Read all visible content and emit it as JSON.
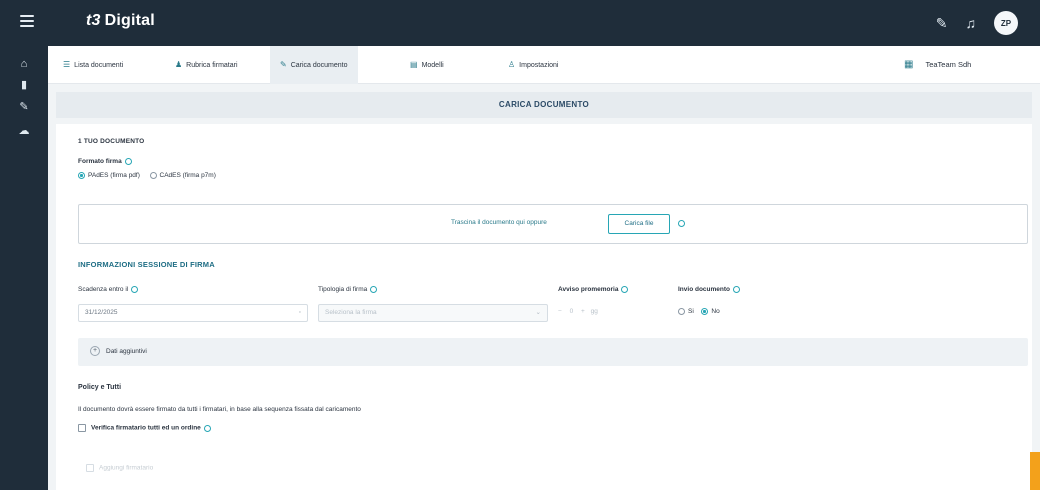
{
  "app": {
    "brand_mark": "t3",
    "brand_name": "Digital"
  },
  "topbar": {
    "icons": [
      {
        "name": "notes-icon",
        "glyph": "✎"
      },
      {
        "name": "bell-icon",
        "glyph": "♫"
      }
    ],
    "avatar_initials": "ZP"
  },
  "sidebar": {
    "items": [
      {
        "name": "home-icon",
        "glyph": "⌂"
      },
      {
        "name": "documents-icon",
        "glyph": "▮"
      },
      {
        "name": "signature-icon",
        "glyph": "✎"
      },
      {
        "name": "cloud-icon",
        "glyph": "☁"
      }
    ]
  },
  "tabs": [
    {
      "icon": "☰",
      "label": "Lista documenti"
    },
    {
      "icon": "♟",
      "label": "Rubrica firmatari"
    },
    {
      "icon": "✎",
      "label": "Carica documento"
    },
    {
      "icon": "▤",
      "label": "Modelli"
    },
    {
      "icon": "♙",
      "label": "Impostazioni"
    }
  ],
  "tab_right": {
    "icon": "▦",
    "label": "TeaTeam Sdh"
  },
  "page_title": "CARICA DOCUMENTO",
  "upload_section": {
    "title": "1 TUO DOCUMENTO",
    "format_label": "Formato firma",
    "options": [
      "PAdES (firma pdf)",
      "CAdES (firma p7m)"
    ],
    "dropzone_text": "Trascina il documento qui oppure",
    "button_label": "Carica file"
  },
  "session_section": {
    "title": "INFORMAZIONI SESSIONE DI FIRMA",
    "fields": {
      "scadenza": {
        "label": "Scadenza entro il",
        "value": "31/12/2025"
      },
      "tipologia": {
        "label": "Tipologia di firma",
        "placeholder": "Seleziona la firma"
      },
      "promemoria": {
        "label": "Avviso promemoria",
        "value": "gg"
      },
      "ordine": {
        "label": "Invio documento",
        "options": [
          "Si",
          "No"
        ]
      }
    },
    "accordion_label": "Dati aggiuntivi"
  },
  "policy_section": {
    "title": "Policy e Tutti",
    "description": "Il documento dovrà essere firmato da tutti i firmatari, in base alla sequenza fissata dal caricamento",
    "checkbox_label": "Verifica firmatario tutti ed un ordine"
  },
  "footer_button": "Aggiungi firmatario"
}
